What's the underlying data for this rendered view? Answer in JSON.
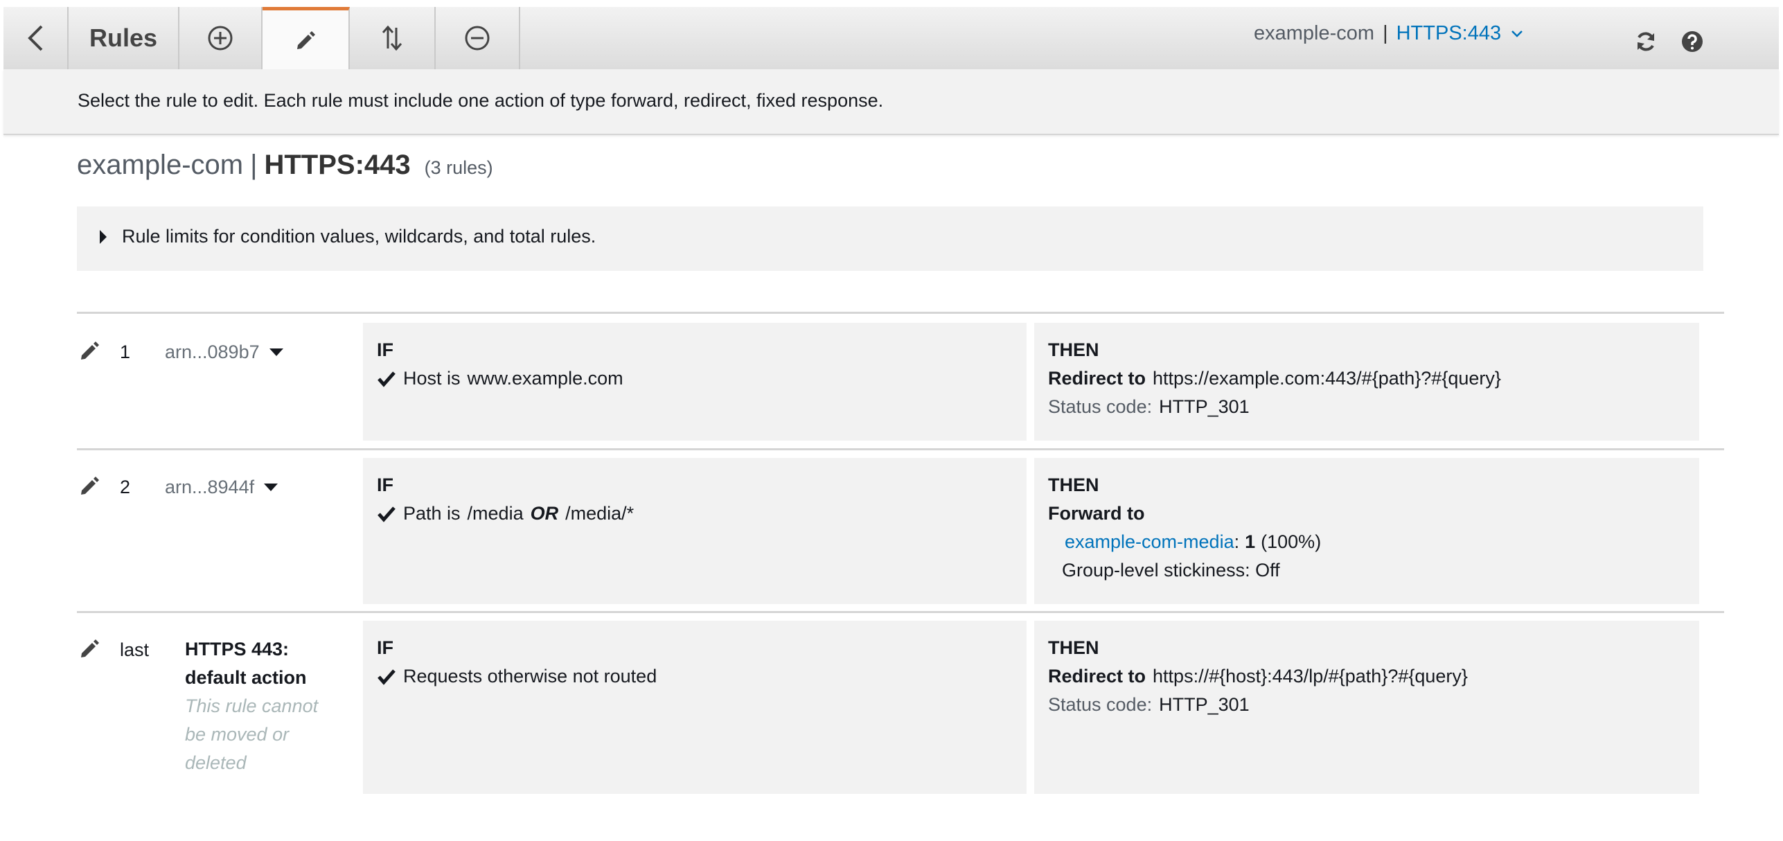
{
  "toolbar": {
    "title": "Rules",
    "listener_lb": "example-com",
    "listener_sep": "|",
    "listener_proto": "HTTPS:443"
  },
  "info": "Select the rule to edit. Each rule must include one action of type forward, redirect, fixed response.",
  "heading": {
    "lb": "example-com",
    "sep": "|",
    "proto": "HTTPS:443",
    "count": "(3 rules)"
  },
  "limits": "Rule limits for condition values, wildcards, and total rules.",
  "icons": {
    "back": "chevron-left-icon",
    "add": "plus-circle-icon",
    "edit": "pencil-icon",
    "reorder": "reorder-arrows-icon",
    "delete": "minus-circle-icon",
    "refresh": "refresh-icon",
    "help": "help-icon",
    "check": "checkmark-icon",
    "caret": "caret-right-icon"
  },
  "colors": {
    "accent_tab": "#e07b39",
    "link": "#0073bb"
  },
  "rules": [
    {
      "priority": "1",
      "arn": "arn...089b7",
      "if_label": "IF",
      "cond_field": "Host is",
      "cond_value": "www.example.com",
      "then_label": "THEN",
      "action_label": "Redirect to",
      "action_value": "https://example.com:443/#{path}?#{query}",
      "status_label": "Status code:",
      "status_value": "HTTP_301"
    },
    {
      "priority": "2",
      "arn": "arn...8944f",
      "if_label": "IF",
      "cond_field": "Path is",
      "cond_value1": "/media",
      "cond_or": "OR",
      "cond_value2": "/media/*",
      "then_label": "THEN",
      "action_label": "Forward to",
      "target_group": "example-com-media",
      "target_sep": ":",
      "weight": "1",
      "weight_pct": "(100%)",
      "stickiness": "Group-level stickiness: Off"
    },
    {
      "priority": "last",
      "title_line1": "HTTPS 443:",
      "title_line2": "default action",
      "note_line1": "This rule cannot",
      "note_line2": "be moved or",
      "note_line3": "deleted",
      "if_label": "IF",
      "cond_text": "Requests otherwise not routed",
      "then_label": "THEN",
      "action_label": "Redirect to",
      "action_value": "https://#{host}:443/lp/#{path}?#{query}",
      "status_label": "Status code:",
      "status_value": "HTTP_301"
    }
  ]
}
